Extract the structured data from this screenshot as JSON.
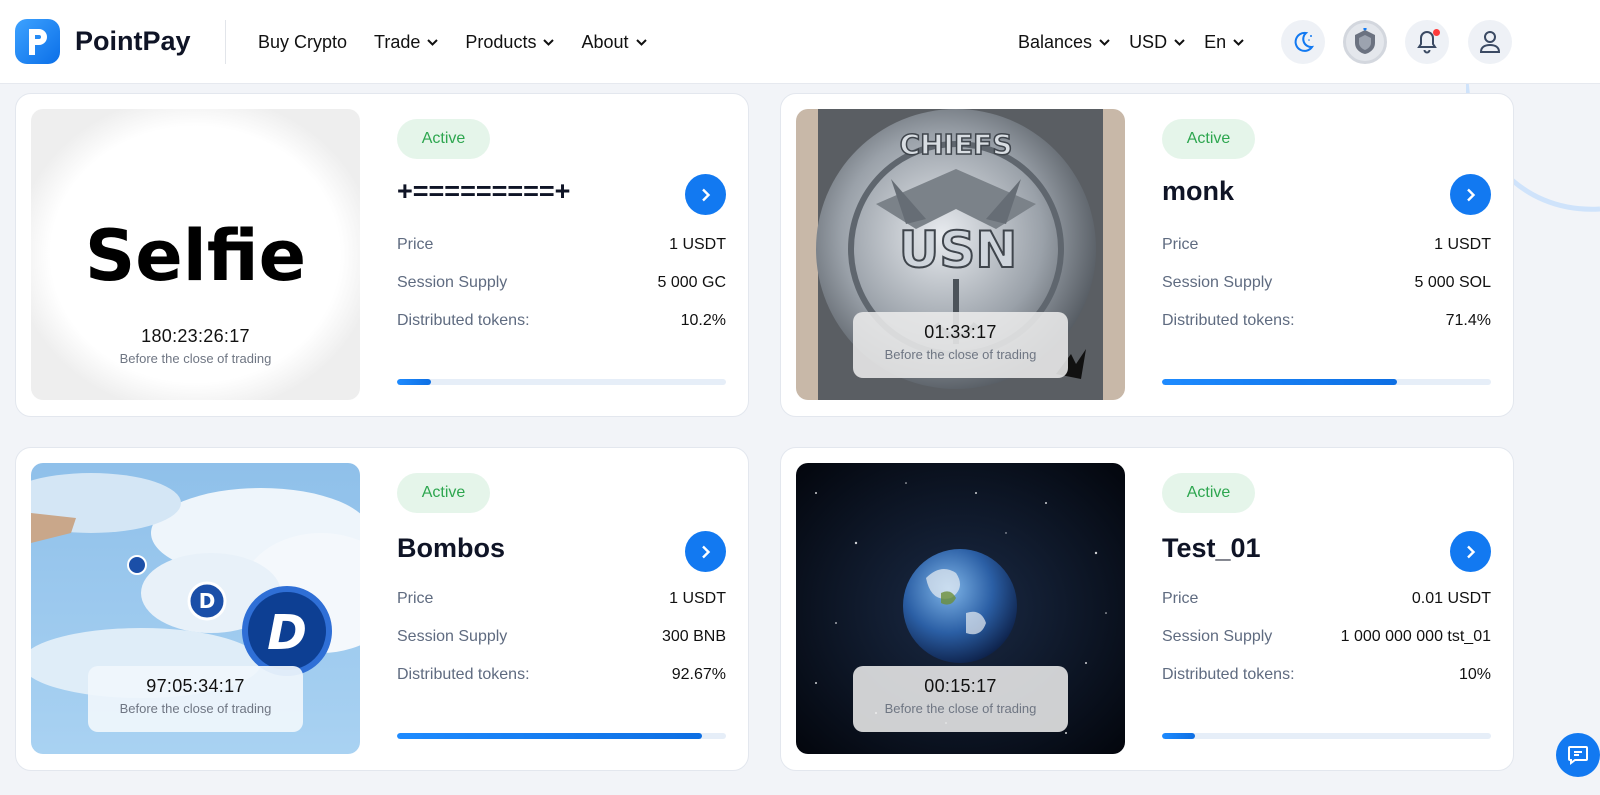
{
  "header": {
    "brand": "PointPay",
    "nav": [
      "Buy Crypto",
      "Trade",
      "Products",
      "About"
    ],
    "balances": "Balances",
    "currency": "USD",
    "language": "En"
  },
  "labels": {
    "price": "Price",
    "session_supply": "Session Supply",
    "distributed": "Distributed tokens:",
    "timer_caption": "Before the close of trading"
  },
  "cards": [
    {
      "status": "Active",
      "title": "+=========+",
      "image_text": "Selfie",
      "timer": "180:23:26:17",
      "price": "1 USDT",
      "supply": "5 000 GC",
      "distributed": "10.2%",
      "progress": 0.102
    },
    {
      "status": "Active",
      "title": "monk",
      "image_text": "",
      "timer": "01:33:17",
      "price": "1 USDT",
      "supply": "5 000 SOL",
      "distributed": "71.4%",
      "progress": 0.714
    },
    {
      "status": "Active",
      "title": "Bombos",
      "image_text": "",
      "timer": "97:05:34:17",
      "price": "1 USDT",
      "supply": "300 BNB",
      "distributed": "92.67%",
      "progress": 0.9267
    },
    {
      "status": "Active",
      "title": "Test_01",
      "image_text": "",
      "timer": "00:15:17",
      "price": "0.01 USDT",
      "supply": "1 000 000 000 tst_01",
      "distributed": "10%",
      "progress": 0.1
    }
  ],
  "colors": {
    "accent": "#1279f1",
    "active_bg": "#e5f5ea",
    "active_text": "#2da64f"
  }
}
